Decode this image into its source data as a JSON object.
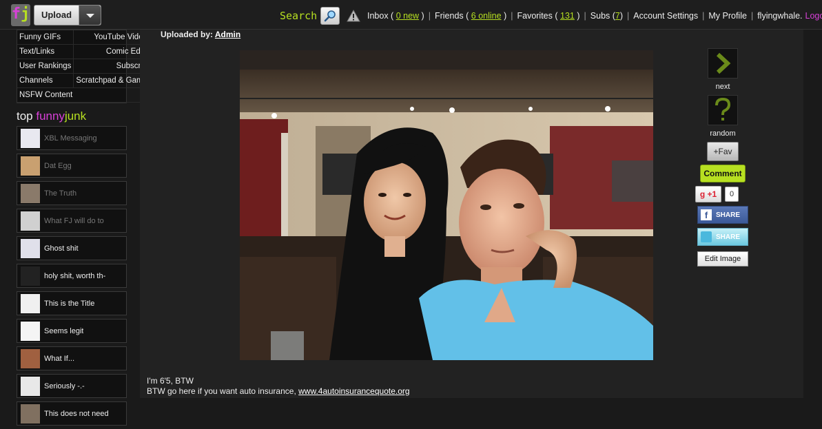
{
  "topbar": {
    "logo_f": "f",
    "logo_j": "j",
    "upload_label": "Upload",
    "search_label": "Search",
    "nav": {
      "inbox_label": "Inbox (",
      "inbox_count": "0 new",
      "inbox_close": ")",
      "friends_label": "Friends (",
      "friends_count": "6 online",
      "friends_close": ")",
      "favorites_label": "Favorites (",
      "favorites_count": "131",
      "favorites_close": ")",
      "subs_label": "Subs (",
      "subs_count": "7",
      "subs_close": ")",
      "account_settings": "Account Settings",
      "my_profile": "My Profile",
      "username": "flyingwhale.",
      "logout": "Logout"
    },
    "icons": {
      "search": "magnifier-icon",
      "alert": "warning-icon"
    }
  },
  "sidebar": {
    "menu": [
      {
        "label": "Funny GIFs"
      },
      {
        "label": "YouTube Videos"
      },
      {
        "label": "Text/Links"
      },
      {
        "label": "Comic Editor"
      },
      {
        "label": "User Rankings"
      },
      {
        "label": "Subscribe"
      },
      {
        "label": "Channels"
      },
      {
        "label": "Scratchpad & Games"
      },
      {
        "label": "NSFW Content"
      }
    ],
    "top_heading": {
      "prefix": "top ",
      "fun": "funny",
      "junk": "junk"
    },
    "top_items": [
      {
        "title": "XBL Messaging",
        "dim": true,
        "thumb_color": "#e8e8f0"
      },
      {
        "title": "Dat Egg",
        "dim": true,
        "thumb_color": "#c9a070"
      },
      {
        "title": "The Truth",
        "dim": true,
        "thumb_color": "#8a7a6a"
      },
      {
        "title": "What FJ will do to",
        "dim": true,
        "thumb_color": "#d0d0d0"
      },
      {
        "title": "Ghost shit",
        "dim": false,
        "thumb_color": "#e0e0ea"
      },
      {
        "title": "holy shit, worth th-",
        "dim": false,
        "thumb_color": "#222"
      },
      {
        "title": "This is the Title",
        "dim": false,
        "thumb_color": "#f0f0f0"
      },
      {
        "title": "Seems legit",
        "dim": false,
        "thumb_color": "#f4f4f4"
      },
      {
        "title": "What If...",
        "dim": false,
        "thumb_color": "#a06040"
      },
      {
        "title": "Seriously -.-",
        "dim": false,
        "thumb_color": "#e8e8e8"
      },
      {
        "title": "This does not need",
        "dim": false,
        "thumb_color": "#807060"
      }
    ]
  },
  "main": {
    "uploaded_by_label": "Uploaded by: ",
    "uploader": "Admin",
    "caption_line1": "I'm 6'5, BTW",
    "caption_line2_prefix": "BTW go here if you want auto insurance, ",
    "caption_link": "www.4autoinsurancequote.org"
  },
  "actions": {
    "next_label": "next",
    "random_label": "random",
    "fav_label": "+Fav",
    "comment_label": "Comment",
    "gplus_label": "+1",
    "gplus_count": "0",
    "fb_share_label": "SHARE",
    "tw_share_label": "SHARE",
    "edit_image_label": "Edit Image"
  },
  "colors": {
    "accent_green": "#b7e021",
    "accent_magenta": "#d840d8",
    "background": "#1a1a1a",
    "panel": "#222222"
  }
}
